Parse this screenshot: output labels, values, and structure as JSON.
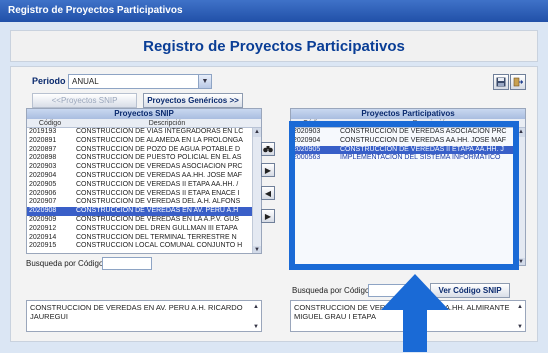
{
  "window_title": "Registro de Proyectos Participativos",
  "header_title": "Registro de Proyectos Participativos",
  "periodo": {
    "label": "Periodo :",
    "value": "ANUAL"
  },
  "buttons": {
    "prev": "<<Proyectos SNIP",
    "genericos": "Proyectos Genéricos >>",
    "ver_codigo": "Ver Código SNIP"
  },
  "left_grid": {
    "title": "Proyectos SNIP",
    "col_codigo": "Código",
    "col_desc": "Descripción",
    "rows": [
      {
        "code": "2019193",
        "desc": "CONSTRUCCION DE VIAS INTEGRADORAS EN LC"
      },
      {
        "code": "2020891",
        "desc": "CONSTRUCCION DE ALAMEDA EN LA PROLONGA"
      },
      {
        "code": "2020897",
        "desc": "CONSTRUCCION DE POZO DE AGUA POTABLE D"
      },
      {
        "code": "2020898",
        "desc": "CONSTRUCCION DE PUESTO POLICIAL EN EL AS"
      },
      {
        "code": "2020903",
        "desc": "CONSTRUCCION DE VEREDAS ASOCIACION PRC"
      },
      {
        "code": "2020904",
        "desc": "CONSTRUCCION DE VEREDAS AA.HH. JOSE MAF"
      },
      {
        "code": "2020905",
        "desc": "CONSTRUCCION DE VEREDAS II ETAPA AA.HH. /"
      },
      {
        "code": "2020906",
        "desc": "CONSTRUCCION DE VEREDAS II ETAPA ENACE I"
      },
      {
        "code": "2020907",
        "desc": "CONSTRUCCION DE VEREDAS DEL A.H. ALFONS"
      },
      {
        "code": "2020908",
        "desc": "CONSTRUCCION DE VEREDAS EN AV. PERU A.H"
      },
      {
        "code": "2020909",
        "desc": "CONSTRUCCION DE VEREDAS EN LA A.P.V. GUS"
      },
      {
        "code": "2020912",
        "desc": "CONSTRUCCION DEL DREN GULLMAN III ETAPA"
      },
      {
        "code": "2020914",
        "desc": "CONSTRUCCION DEL TERMINAL TERRESTRE N"
      },
      {
        "code": "2020915",
        "desc": "CONSTRUCCION LOCAL COMUNAL CONJUNTO H"
      }
    ]
  },
  "right_grid": {
    "title": "Proyectos Participativos",
    "col_codigo": "Código",
    "col_desc": "Descripción",
    "rows": [
      {
        "code": "2020903",
        "desc": "CONSTRUCCION DE VEREDAS ASOCIACION PRC"
      },
      {
        "code": "2020904",
        "desc": "CONSTRUCCION DE VEREDAS AA.HH. JOSE MAF"
      },
      {
        "code": "2020905",
        "desc": "CONSTRUCCION DE VEREDAS II ETAPA AA.HH. J"
      },
      {
        "code": "2000563",
        "desc": "IMPLEMENTACION DEL SISTEMA INFORMATICO"
      }
    ]
  },
  "search_label_left": "Busqueda por Código",
  "search_label_right": "Busqueda por Código",
  "memo_left": "CONSTRUCCION DE VEREDAS EN AV. PERU A.H. RICARDO JAUREGUI",
  "memo_right": "CONSTRUCCION DE VEREDAS EN TAPA AA.HH. ALMIRANTE MIGUEL GRAU I ETAPA",
  "transfer_buttons": [
    "▶",
    "◀",
    "▶"
  ],
  "accent_color": "#1a6ad6"
}
